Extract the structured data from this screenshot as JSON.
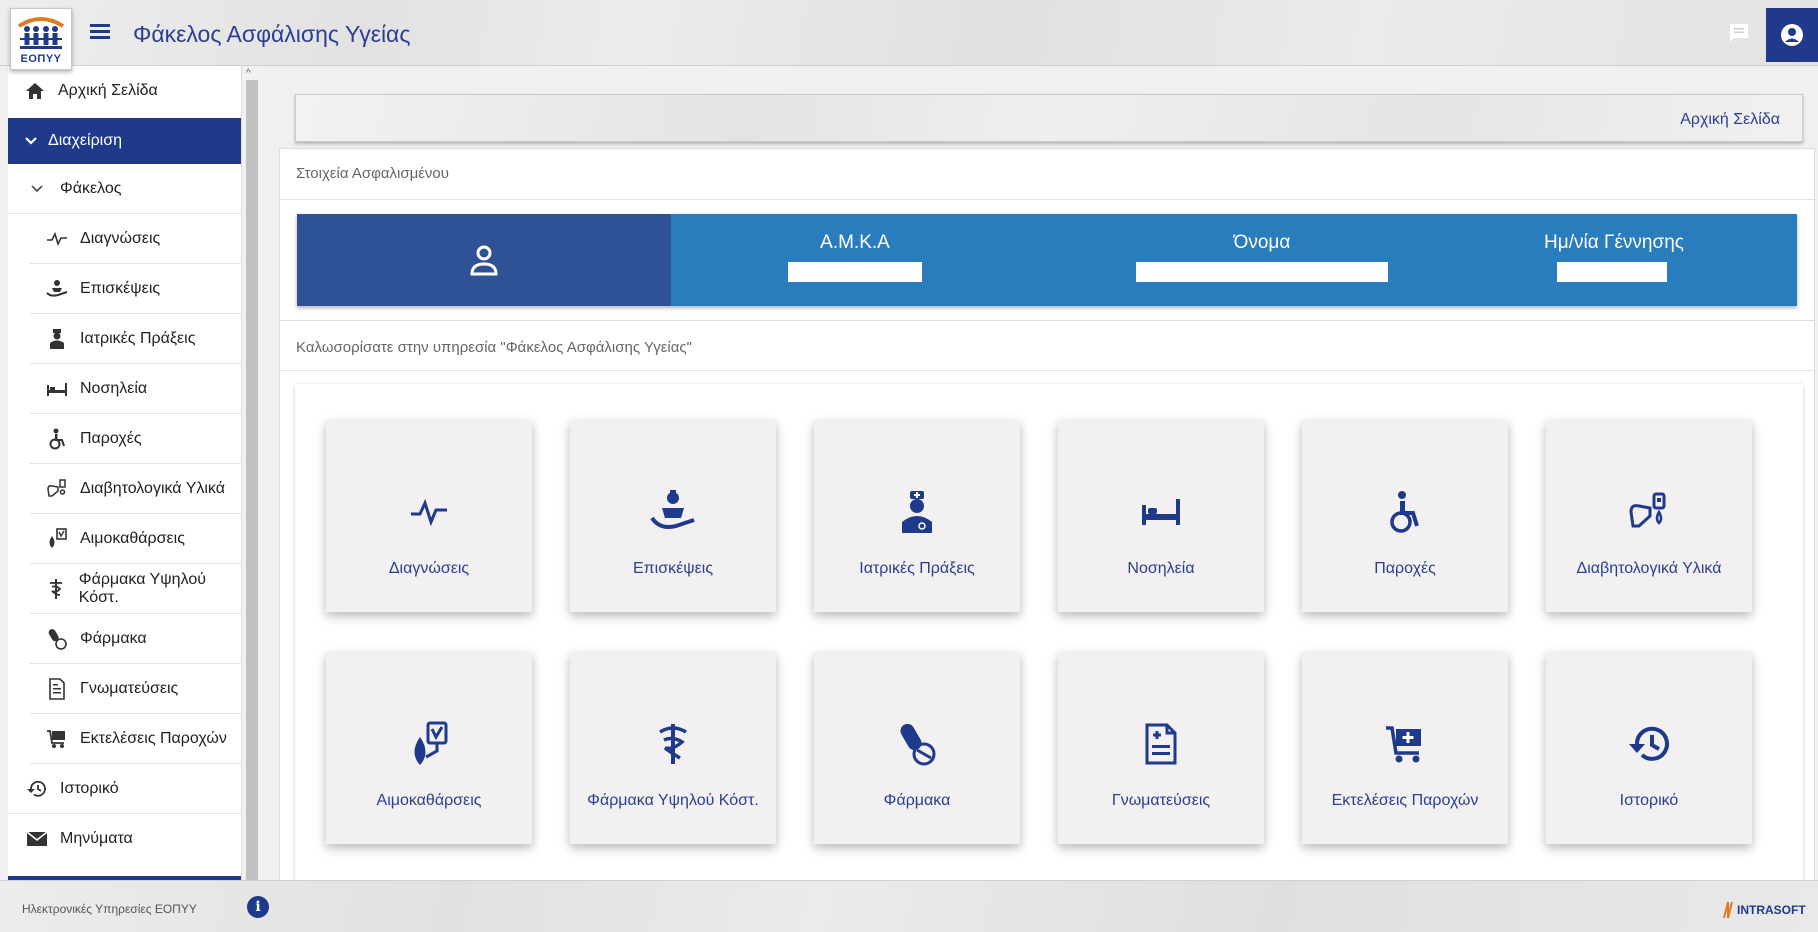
{
  "header": {
    "logo_text": "ΕΟΠΥΥ",
    "title": "Φάκελος Ασφάλισης Υγείας"
  },
  "sidebar": {
    "home": "Αρχική Σελίδα",
    "management": "Διαχείριση",
    "folder": "Φάκελος",
    "items": [
      {
        "label": "Διαγνώσεις",
        "icon": "pulse-icon"
      },
      {
        "label": "Επισκέψεις",
        "icon": "patient-bed-icon"
      },
      {
        "label": "Ιατρικές Πράξεις",
        "icon": "doctor-icon"
      },
      {
        "label": "Νοσηλεία",
        "icon": "bed-icon"
      },
      {
        "label": "Παροχές",
        "icon": "wheelchair-icon"
      },
      {
        "label": "Διαβητολογικά Υλικά",
        "icon": "glucose-meter-icon"
      },
      {
        "label": "Αιμοκαθάρσεις",
        "icon": "blood-drop-icon"
      },
      {
        "label": "Φάρμακα Υψηλού Κόστ.",
        "icon": "caduceus-icon"
      },
      {
        "label": "Φάρμακα",
        "icon": "pills-icon"
      },
      {
        "label": "Γνωματεύσεις",
        "icon": "medical-document-icon"
      },
      {
        "label": "Εκτελέσεις Παροχών",
        "icon": "medical-cart-icon"
      }
    ],
    "history": "Ιστορικό",
    "messages": "Μηνύματα"
  },
  "main": {
    "breadcrumb": "Αρχική Σελίδα",
    "insured_panel_title": "Στοιχεία Ασφαλισμένου",
    "insured": {
      "amka_label": "Α.Μ.Κ.Α",
      "name_label": "Όνομα",
      "dob_label": "Ημ/νία Γέννησης"
    },
    "welcome": "Καλωσορίσατε στην υπηρεσία \"Φάκελος Ασφάλισης Υγείας\"",
    "tiles": [
      {
        "label": "Διαγνώσεις",
        "icon": "pulse-icon"
      },
      {
        "label": "Επισκέψεις",
        "icon": "patient-bed-icon"
      },
      {
        "label": "Ιατρικές Πράξεις",
        "icon": "doctor-icon"
      },
      {
        "label": "Νοσηλεία",
        "icon": "bed-icon"
      },
      {
        "label": "Παροχές",
        "icon": "wheelchair-icon"
      },
      {
        "label": "Διαβητολογικά Υλικά",
        "icon": "glucose-meter-icon"
      },
      {
        "label": "Αιμοκαθάρσεις",
        "icon": "blood-drop-icon"
      },
      {
        "label": "Φάρμακα Υψηλού Κόστ.",
        "icon": "caduceus-icon"
      },
      {
        "label": "Φάρμακα",
        "icon": "pills-icon"
      },
      {
        "label": "Γνωματεύσεις",
        "icon": "medical-document-icon"
      },
      {
        "label": "Εκτελέσεις Παροχών",
        "icon": "medical-cart-icon"
      },
      {
        "label": "Ιστορικό",
        "icon": "history-icon"
      }
    ]
  },
  "footer": {
    "text": "Ηλεκτρονικές Υπηρεσίες ΕΟΠΥΥ",
    "brand": "INTRASOFT"
  },
  "colors": {
    "primary": "#1f3a8a",
    "insured_bar": "#2a7dbd",
    "insured_bar_left": "#2f5196"
  }
}
